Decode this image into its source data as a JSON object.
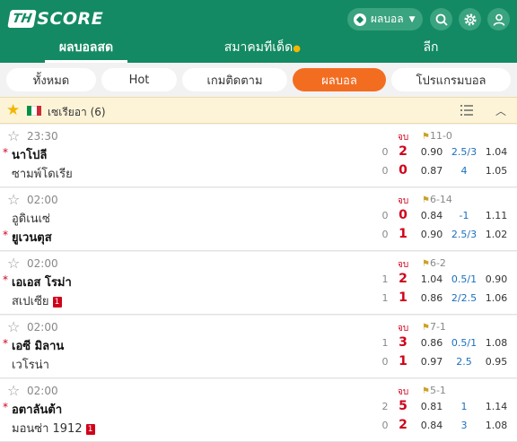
{
  "brand": {
    "logo_th": "TH",
    "logo_score": "SCORE"
  },
  "header": {
    "sport_label": "ผลบอล",
    "search_icon": "search-icon",
    "settings_icon": "gear-icon",
    "user_icon": "user-icon"
  },
  "nav": {
    "tabs": [
      {
        "label": "ผลบอลสด"
      },
      {
        "label": "สมาคมทีเด็ด"
      },
      {
        "label": "ลีก"
      }
    ]
  },
  "filters": [
    {
      "label": "ทั้งหมด"
    },
    {
      "label": "Hot"
    },
    {
      "label": "เกมติดตาม"
    },
    {
      "label": "ผลบอล"
    },
    {
      "label": "โปรแกรมบอล"
    }
  ],
  "league": {
    "name": "เซเรียอา (6)",
    "flag_colors": [
      "#009246",
      "#ffffff",
      "#ce2b37"
    ]
  },
  "colors": {
    "brand": "#138a63",
    "accent": "#f36d21",
    "score_red": "#d0021b",
    "odds_blue": "#1a6fbf"
  },
  "matches": [
    {
      "time": "23:30",
      "status": "จบ",
      "corners": "11-0",
      "home": {
        "name": "นาโปลี",
        "bold": true,
        "ht": "0",
        "ft": "2",
        "red": "",
        "o1": "0.90",
        "o2": "2.5/3",
        "o3": "1.04"
      },
      "away": {
        "name": "ซามพ์โดเรีย",
        "bold": false,
        "ht": "0",
        "ft": "0",
        "red": "",
        "o1": "0.87",
        "o2": "4",
        "o3": "1.05"
      }
    },
    {
      "time": "02:00",
      "status": "จบ",
      "corners": "6-14",
      "home": {
        "name": "อูดิเนเซ่",
        "bold": false,
        "ht": "0",
        "ft": "0",
        "red": "",
        "o1": "0.84",
        "o2": "-1",
        "o3": "1.11"
      },
      "away": {
        "name": "ยูเวนตุส",
        "bold": true,
        "ht": "0",
        "ft": "1",
        "red": "",
        "o1": "0.90",
        "o2": "2.5/3",
        "o3": "1.02"
      }
    },
    {
      "time": "02:00",
      "status": "จบ",
      "corners": "6-2",
      "home": {
        "name": "เอเอส โรม่า",
        "bold": true,
        "ht": "1",
        "ft": "2",
        "red": "",
        "o1": "1.04",
        "o2": "0.5/1",
        "o3": "0.90"
      },
      "away": {
        "name": "สเปเซีย",
        "bold": false,
        "ht": "1",
        "ft": "1",
        "red": "1",
        "o1": "0.86",
        "o2": "2/2.5",
        "o3": "1.06"
      }
    },
    {
      "time": "02:00",
      "status": "จบ",
      "corners": "7-1",
      "home": {
        "name": "เอซี มิลาน",
        "bold": true,
        "ht": "1",
        "ft": "3",
        "red": "",
        "o1": "0.86",
        "o2": "0.5/1",
        "o3": "1.08"
      },
      "away": {
        "name": "เวโรน่า",
        "bold": false,
        "ht": "0",
        "ft": "1",
        "red": "",
        "o1": "0.97",
        "o2": "2.5",
        "o3": "0.95"
      }
    },
    {
      "time": "02:00",
      "status": "จบ",
      "corners": "5-1",
      "home": {
        "name": "อตาลันต้า",
        "bold": true,
        "ht": "2",
        "ft": "5",
        "red": "",
        "o1": "0.81",
        "o2": "1",
        "o3": "1.14"
      },
      "away": {
        "name": "มอนซ่า 1912",
        "bold": false,
        "ht": "0",
        "ft": "2",
        "red": "1",
        "o1": "0.84",
        "o2": "3",
        "o3": "1.08"
      }
    }
  ]
}
